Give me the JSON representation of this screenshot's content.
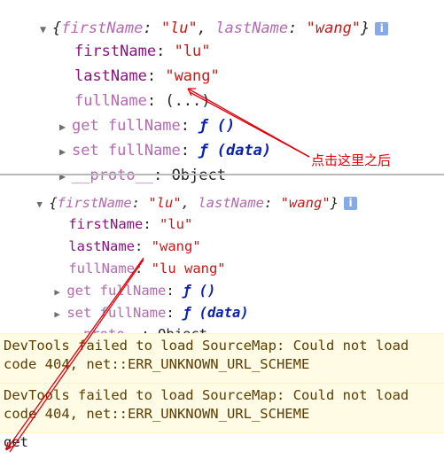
{
  "panel1": {
    "summary": {
      "open": "{",
      "k1": "firstName",
      "sep1": ": ",
      "v1": "\"lu\"",
      "comma": ", ",
      "k2": "lastName",
      "sep2": ": ",
      "v2": "\"wang\"",
      "close": "}"
    },
    "firstName_key": "firstName",
    "firstName_val": "\"lu\"",
    "lastName_key": "lastName",
    "lastName_val": "\"wang\"",
    "fullName_key": "fullName",
    "fullName_val": "(...)",
    "getter_label": "get fullName",
    "getter_fn": "ƒ ()",
    "setter_label": "set fullName",
    "setter_fn": "ƒ (data)",
    "proto_key": "__proto__",
    "proto_val": "Object"
  },
  "panel2": {
    "summary": {
      "open": "{",
      "k1": "firstName",
      "sep1": ": ",
      "v1": "\"lu\"",
      "comma": ", ",
      "k2": "lastName",
      "sep2": ": ",
      "v2": "\"wang\"",
      "close": "}"
    },
    "firstName_key": "firstName",
    "firstName_val": "\"lu\"",
    "lastName_key": "lastName",
    "lastName_val": "\"wang\"",
    "fullName_key": "fullName",
    "fullName_val": "\"lu wang\"",
    "getter_label": "get fullName",
    "getter_fn": "ƒ ()",
    "setter_label": "set fullName",
    "setter_fn": "ƒ (data)",
    "proto_key": "__proto__",
    "proto_val": "Object"
  },
  "info_glyph": "i",
  "expand_glyph": "▼",
  "collapse_glyph": "▶",
  "annotation": "点击这里之后",
  "warnings": [
    {
      "line1": "DevTools failed to load SourceMap: Could not load",
      "line2": "code 404, net::ERR_UNKNOWN_URL_SCHEME"
    },
    {
      "line1": "DevTools failed to load SourceMap: Could not load",
      "line2": "code 404, net::ERR_UNKNOWN_URL_SCHEME"
    }
  ],
  "output": "get",
  "colors": {
    "key": "#881280",
    "string": "#c41a16",
    "function": "#0d22aa",
    "annotation": "#e0000b",
    "warning_bg": "#fffbe5"
  },
  "icons": [
    "expand-triangle-icon",
    "collapse-triangle-icon",
    "info-icon"
  ]
}
